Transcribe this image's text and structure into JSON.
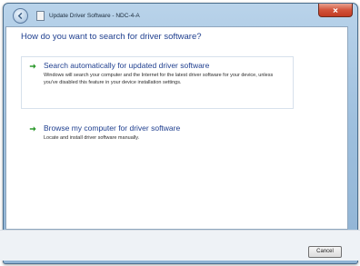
{
  "window": {
    "title": "Update Driver Software - NDC-4-A"
  },
  "main": {
    "heading": "How do you want to search for driver software?",
    "options": [
      {
        "title": "Search automatically for updated driver software",
        "description": "Windows will search your computer and the Internet for the latest driver software for your device, unless you've disabled this feature in your device installation settings."
      },
      {
        "title": "Browse my computer for driver software",
        "description": "Locate and install driver software manually."
      }
    ]
  },
  "footer": {
    "cancel_label": "Cancel"
  },
  "icons": {
    "back": "back-arrow-icon",
    "driver": "driver-icon",
    "close": "close-icon",
    "option_arrow": "green-arrow-icon"
  },
  "colors": {
    "link_blue": "#1f3f8f",
    "arrow_green": "#2e9a2e",
    "close_red": "#c23b22"
  }
}
